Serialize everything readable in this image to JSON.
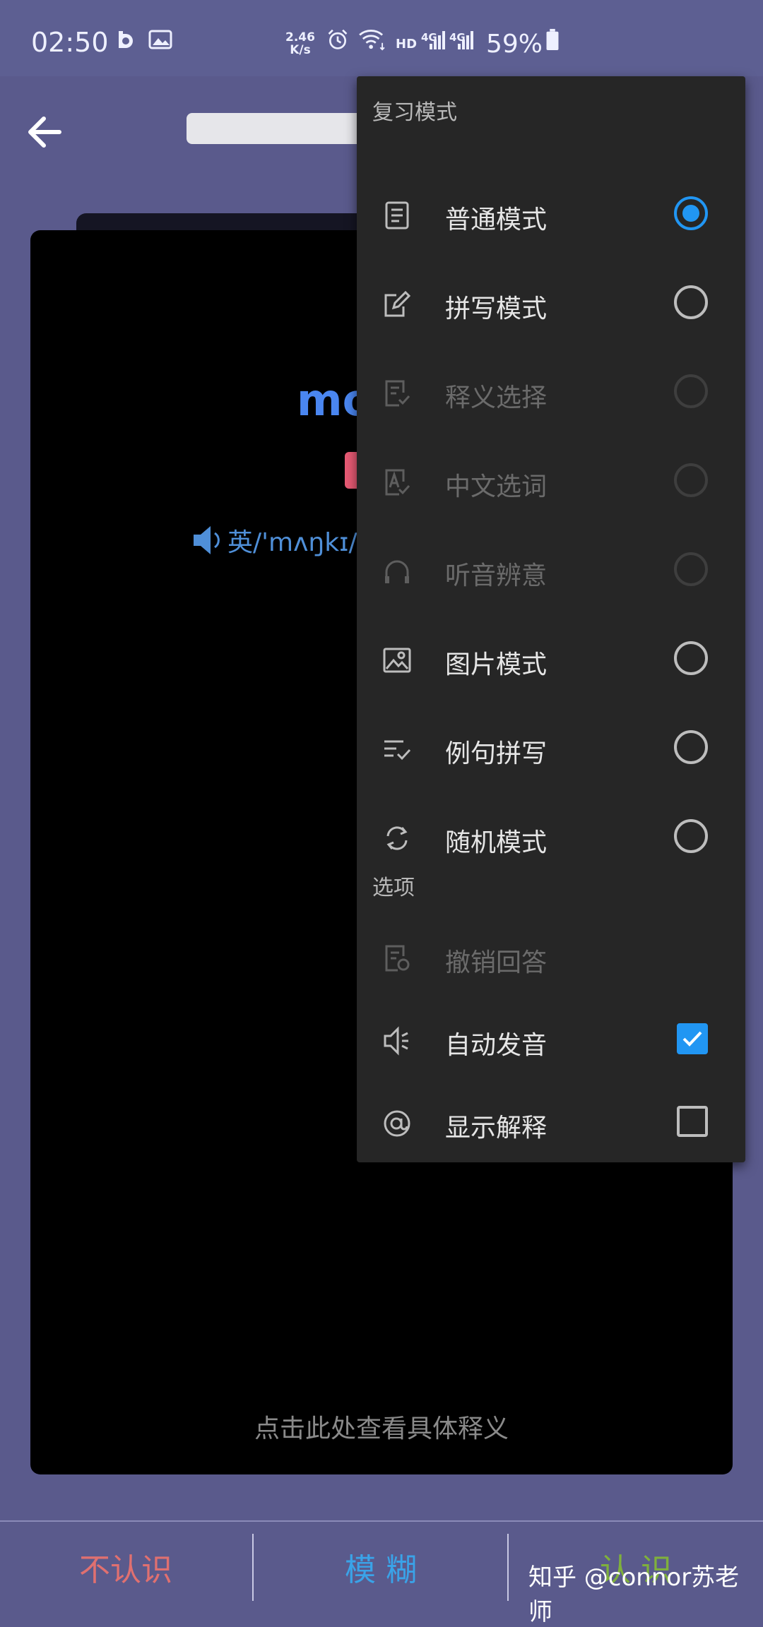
{
  "status_bar": {
    "time": "02:50",
    "net_speed_value": "2.46",
    "net_speed_unit": "K/s",
    "network": "HD",
    "signal1": "4G",
    "signal2": "4G",
    "battery": "59%",
    "icons": [
      "notification-app-icon",
      "gallery-icon",
      "alarm-icon",
      "wifi-icon",
      "signal-icon",
      "battery-icon"
    ]
  },
  "card": {
    "word_partial": "mo",
    "phonetic": "英/'mʌŋkɪ/",
    "hint": "点击此处查看具体释义"
  },
  "bottom_bar": {
    "unknown": "不认识",
    "fuzzy": "模 糊",
    "known": "认 识",
    "unknown_color": "#e07070",
    "fuzzy_color": "#3aa3e8",
    "known_color": "#7fb03c"
  },
  "watermark": "知乎 @connor苏老师",
  "menu": {
    "section_review": "复习模式",
    "review_items": [
      {
        "label": "普通模式",
        "icon": "document-icon",
        "state": "checked"
      },
      {
        "label": "拼写模式",
        "icon": "edit-icon",
        "state": "unchecked"
      },
      {
        "label": "释义选择",
        "icon": "document-check-icon",
        "state": "disabled"
      },
      {
        "label": "中文选词",
        "icon": "letter-a-check-icon",
        "state": "disabled"
      },
      {
        "label": "听音辨意",
        "icon": "headphones-icon",
        "state": "disabled"
      },
      {
        "label": "图片模式",
        "icon": "image-icon",
        "state": "unchecked"
      },
      {
        "label": "例句拼写",
        "icon": "list-check-icon",
        "state": "unchecked"
      },
      {
        "label": "随机模式",
        "icon": "shuffle-icon",
        "state": "unchecked"
      }
    ],
    "section_options": "选项",
    "option_items": [
      {
        "label": "撤销回答",
        "icon": "undo-document-icon",
        "state": "disabled"
      },
      {
        "label": "自动发音",
        "icon": "speaker-icon",
        "state": "checked"
      },
      {
        "label": "显示解释",
        "icon": "at-icon",
        "state": "unchecked"
      }
    ]
  },
  "accent_color": "#2196f3"
}
